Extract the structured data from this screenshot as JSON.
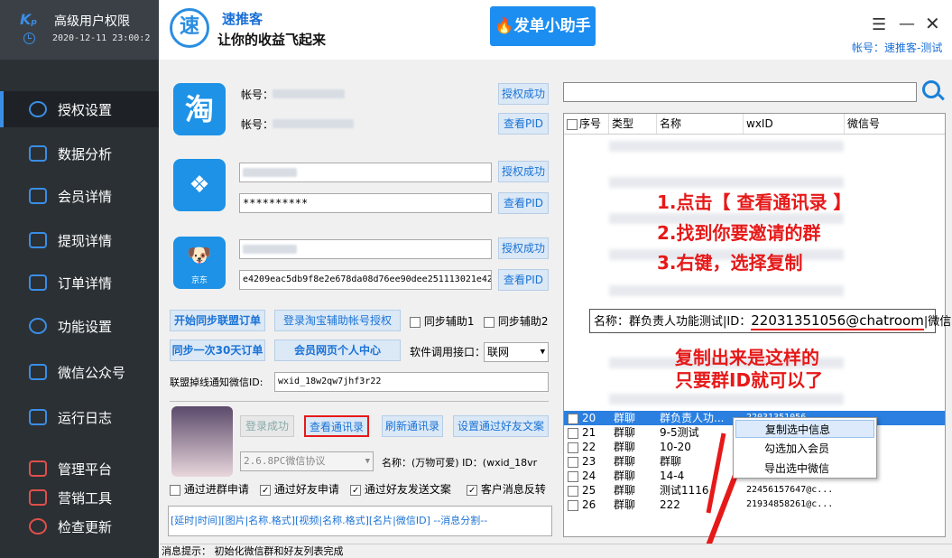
{
  "sidebar": {
    "app_title": "高级用户权限",
    "datetime": "2020-12-11 23:00:2",
    "items": [
      {
        "label": "授权设置",
        "icon": "globe-icon"
      },
      {
        "label": "数据分析",
        "icon": "chart-icon"
      },
      {
        "label": "会员详情",
        "icon": "edit-icon"
      },
      {
        "label": "提现详情",
        "icon": "search-doc-icon"
      },
      {
        "label": "订单详情",
        "icon": "yen-doc-icon"
      },
      {
        "label": "功能设置",
        "icon": "chat-icon"
      },
      {
        "label": "微信公众号",
        "icon": "keyboard-icon"
      },
      {
        "label": "运行日志",
        "icon": "speaker-icon"
      },
      {
        "label": "管理平台",
        "icon": "list-icon"
      },
      {
        "label": "营销工具",
        "icon": "tools-icon"
      },
      {
        "label": "检查更新",
        "icon": "update-icon"
      }
    ]
  },
  "header": {
    "logo_char": "速",
    "name": "速推客",
    "slogan": "让你的收益飞起来",
    "promo_button": "发单小助手",
    "account": "帐号：速推客-测试"
  },
  "taobao": {
    "icon_char": "淘",
    "account_label1": "帐号：",
    "account_label2": "帐号：",
    "btn_auth": "授权成功",
    "btn_pid": "查看PID"
  },
  "pdd": {
    "password": "**********",
    "btn_auth": "授权成功",
    "btn_pid": "查看PID"
  },
  "jd": {
    "icon_label": "京东",
    "pid_value": "e4209eac5db9f8e2e678da08d76ee90dee251113021e42",
    "btn_auth": "授权成功",
    "btn_pid": "查看PID"
  },
  "actions": {
    "sync_union_orders": "开始同步联盟订单",
    "login_taobao_helper": "登录淘宝辅助帐号授权",
    "sync_helper1": "同步辅助1",
    "sync_helper2": "同步辅助2",
    "sync_30days": "同步一次30天订单",
    "member_center": "会员网页个人中心",
    "api_label": "软件调用接口：",
    "api_value": "联网",
    "notify_label": "联盟掉线通知微信ID:",
    "notify_value": "wxid_18w2qw7jhf3r22"
  },
  "wechat": {
    "login_ok": "登录成功",
    "view_contacts": "查看通讯录",
    "refresh_contacts": "刷新通讯录",
    "set_friend_msg": "设置通过好友文案",
    "protocol": "2.6.8PC微信协议",
    "name_line": "名称：(万物可爱) ID：(wxid_18vr",
    "cb_group_apply": "通过进群申请",
    "cb_friend_apply": "通过好友申请",
    "cb_friend_msg": "通过好友发送文案",
    "cb_msg_feedback": "客户消息反转",
    "format_hint": "[延时|时间][图片|名称.格式][视频|名称.格式][名片|微信ID] --消息分割--"
  },
  "table": {
    "columns": [
      "序号",
      "类型",
      "名称",
      "wxID",
      "微信号"
    ],
    "rows": [
      {
        "no": "20",
        "type": "群聊",
        "name": "群负责人功...",
        "wxid": "22031351056...",
        "selected": true
      },
      {
        "no": "21",
        "type": "群聊",
        "name": "9-5测试",
        "wxid": ""
      },
      {
        "no": "22",
        "type": "群聊",
        "name": "10-20",
        "wxid": ""
      },
      {
        "no": "23",
        "type": "群聊",
        "name": "群聊",
        "wxid": ""
      },
      {
        "no": "24",
        "type": "群聊",
        "name": "14-4",
        "wxid": ""
      },
      {
        "no": "25",
        "type": "群聊",
        "name": "测试1116",
        "wxid": "22456157647@c..."
      },
      {
        "no": "26",
        "type": "群聊",
        "name": "222",
        "wxid": "21934858261@c..."
      }
    ]
  },
  "annotations": {
    "step1": "1.点击【 查看通讯录 】",
    "step2": "2.找到你要邀请的群",
    "step3": "3.右键，选择复制",
    "callout_prefix": "名称：群负责人功能测试|ID：",
    "callout_id": "22031351056@chatroom",
    "callout_suffix": "|微信号",
    "note1": "复制出来是这样的",
    "note2": "只要群ID就可以了"
  },
  "context_menu": [
    "复制选中信息",
    "勾选加入会员",
    "导出选中微信"
  ],
  "status": "消息提示：  初始化微信群和好友列表完成",
  "colors": {
    "accent": "#1d92e6",
    "sidebar": "#2b3034",
    "annotation_red": "#e61919"
  }
}
